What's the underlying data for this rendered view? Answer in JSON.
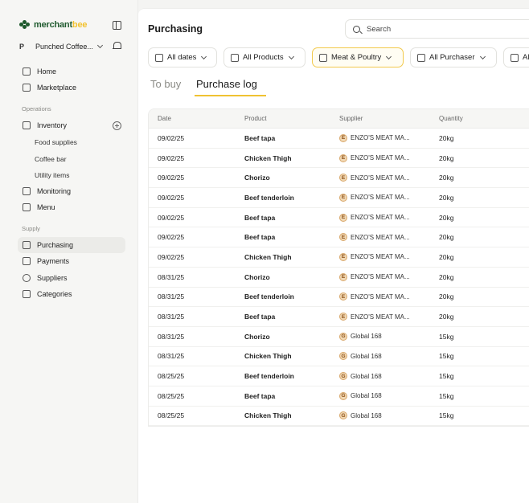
{
  "brand": {
    "name_part1": "merchant",
    "name_part2": "bee"
  },
  "store": {
    "badge": "P",
    "name": "Punched Coffee..."
  },
  "nav": {
    "home": "Home",
    "marketplace": "Marketplace",
    "operations_label": "Operations",
    "inventory": "Inventory",
    "inventory_sub": [
      "Food supplies",
      "Coffee bar",
      "Utility items"
    ],
    "monitoring": "Monitoring",
    "menu": "Menu",
    "supply_label": "Supply",
    "purchasing": "Purchasing",
    "payments": "Payments",
    "suppliers": "Suppliers",
    "categories": "Categories"
  },
  "header": {
    "title": "Purchasing",
    "search_placeholder": "Search"
  },
  "filters": {
    "dates": "All dates",
    "products": "All Products",
    "category": "Meat & Poultry",
    "purchaser": "All Purchaser",
    "more": "All"
  },
  "tabs": {
    "to_buy": "To buy",
    "purchase_log": "Purchase log"
  },
  "table": {
    "columns": [
      "Date",
      "Product",
      "Supplier",
      "Quantity"
    ],
    "rows": [
      {
        "date": "09/02/25",
        "product": "Beef tapa",
        "supplier_initial": "E",
        "supplier": "ENZO'S MEAT MA...",
        "quantity": "20kg"
      },
      {
        "date": "09/02/25",
        "product": "Chicken Thigh",
        "supplier_initial": "E",
        "supplier": "ENZO'S MEAT MA...",
        "quantity": "20kg"
      },
      {
        "date": "09/02/25",
        "product": "Chorizo",
        "supplier_initial": "E",
        "supplier": "ENZO'S MEAT MA...",
        "quantity": "20kg"
      },
      {
        "date": "09/02/25",
        "product": "Beef tenderloin",
        "supplier_initial": "E",
        "supplier": "ENZO'S MEAT MA...",
        "quantity": "20kg"
      },
      {
        "date": "09/02/25",
        "product": "Beef tapa",
        "supplier_initial": "E",
        "supplier": "ENZO'S MEAT MA...",
        "quantity": "20kg"
      },
      {
        "date": "09/02/25",
        "product": "Beef tapa",
        "supplier_initial": "E",
        "supplier": "ENZO'S MEAT MA...",
        "quantity": "20kg"
      },
      {
        "date": "09/02/25",
        "product": "Chicken Thigh",
        "supplier_initial": "E",
        "supplier": "ENZO'S MEAT MA...",
        "quantity": "20kg"
      },
      {
        "date": "08/31/25",
        "product": "Chorizo",
        "supplier_initial": "E",
        "supplier": "ENZO'S MEAT MA...",
        "quantity": "20kg"
      },
      {
        "date": "08/31/25",
        "product": "Beef tenderloin",
        "supplier_initial": "E",
        "supplier": "ENZO'S MEAT MA...",
        "quantity": "20kg"
      },
      {
        "date": "08/31/25",
        "product": "Beef tapa",
        "supplier_initial": "E",
        "supplier": "ENZO'S MEAT MA...",
        "quantity": "20kg"
      },
      {
        "date": "08/31/25",
        "product": "Chorizo",
        "supplier_initial": "G",
        "supplier": "Global 168",
        "quantity": "15kg"
      },
      {
        "date": "08/31/25",
        "product": "Chicken Thigh",
        "supplier_initial": "G",
        "supplier": "Global 168",
        "quantity": "15kg"
      },
      {
        "date": "08/25/25",
        "product": "Beef tenderloin",
        "supplier_initial": "G",
        "supplier": "Global 168",
        "quantity": "15kg"
      },
      {
        "date": "08/25/25",
        "product": "Beef tapa",
        "supplier_initial": "G",
        "supplier": "Global 168",
        "quantity": "15kg"
      },
      {
        "date": "08/25/25",
        "product": "Chicken Thigh",
        "supplier_initial": "G",
        "supplier": "Global 168",
        "quantity": "15kg"
      }
    ]
  },
  "colors": {
    "brand_green": "#1f5a2e",
    "brand_yellow": "#f2c230",
    "active_filter_border": "#f2c94c"
  }
}
